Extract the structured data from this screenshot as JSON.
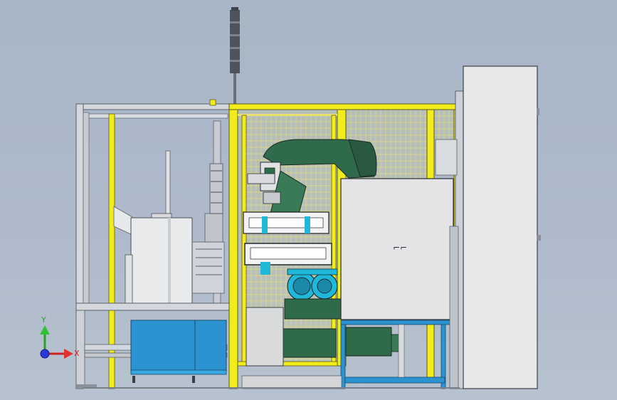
{
  "viewport": {
    "title": "",
    "background_top": "#a8b6c6",
    "background_bottom": "#b7c2cf"
  },
  "colors": {
    "guard_yellow": "#f2ec1a",
    "mesh_yellow": "#e8e070",
    "robot_green": "#2f6a4a",
    "tray_blue": "#2b94d0",
    "cyan": "#20b8d8",
    "panel_gray": "#e4e4e6",
    "frame_gray": "#c8ccd2",
    "steel_dark": "#5a6068"
  },
  "triad": {
    "y_label": "Y",
    "x_label": "X",
    "z_color": "#2a3ad8"
  },
  "labels": {
    "cabinet_door_mark": "⌐⌐"
  }
}
